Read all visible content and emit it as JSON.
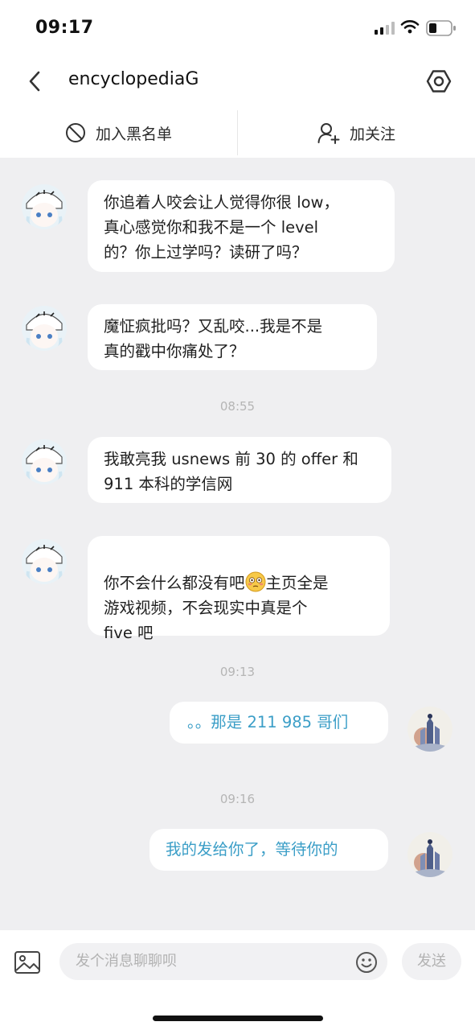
{
  "status": {
    "time": "09:17"
  },
  "nav": {
    "title": "encyclopediaG"
  },
  "actions": {
    "block_label": "加入黑名单",
    "follow_label": "加关注"
  },
  "messages": [
    {
      "from": "other",
      "text": "你追着人咬会让人觉得你很 low，\n真心感觉你和我不是一个 level\n的？你上过学吗？读研了吗？"
    },
    {
      "from": "other",
      "text": "魔怔疯批吗？又乱咬...我是不是\n真的戳中你痛处了？"
    },
    {
      "from": "other",
      "text": "我敢亮我 usnews 前 30 的 offer 和\n911 本科的学信网"
    },
    {
      "from": "other",
      "text_before_emoji": "你不会什么都没有吧",
      "emoji": "flushed-face-emoji",
      "text_after_emoji": "主页全是\n游戏视频，不会现实中真是个\nfive 吧"
    },
    {
      "from": "me",
      "text": "。。那是 211 985 哥们"
    },
    {
      "from": "me",
      "text": "我的发给你了，等待你的"
    }
  ],
  "timestamps": [
    "08:55",
    "09:13",
    "09:16"
  ],
  "composer": {
    "placeholder": "发个消息聊聊呗",
    "send_label": "发送"
  },
  "icons": [
    "back-icon",
    "settings-icon",
    "block-icon",
    "add-user-icon",
    "image-icon",
    "emoji-icon"
  ],
  "colors": {
    "sent_text": "#3b9ec7",
    "background": "#efeff1"
  }
}
